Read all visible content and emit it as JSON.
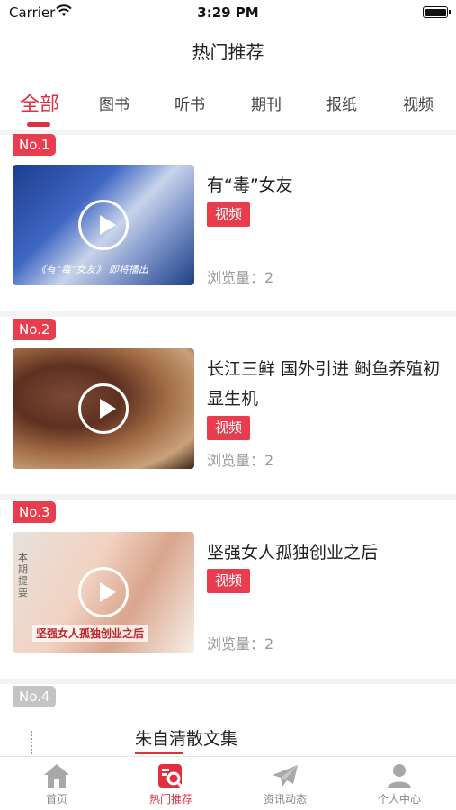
{
  "status": {
    "carrier": "Carrier",
    "time": "3:29 PM"
  },
  "nav": {
    "title": "热门推荐"
  },
  "tabs": [
    {
      "label": "全部",
      "active": true
    },
    {
      "label": "图书",
      "active": false
    },
    {
      "label": "听书",
      "active": false
    },
    {
      "label": "期刊",
      "active": false
    },
    {
      "label": "报纸",
      "active": false
    },
    {
      "label": "视频",
      "active": false
    }
  ],
  "items": [
    {
      "rank": "No.1",
      "title": "有“毒”女友",
      "tag": "视频",
      "views": "浏览量：2",
      "thumb_caption": "《有“毒”女友》  即将播出"
    },
    {
      "rank": "No.2",
      "title": "长江三鲜 国外引进 鲥鱼养殖初显生机",
      "tag": "视频",
      "views": "浏览量：2"
    },
    {
      "rank": "No.3",
      "title": "坚强女人孤独创业之后",
      "tag": "视频",
      "views": "浏览量：2",
      "thumb_caption": "坚强女人孤独创业之后",
      "thumb_side": "本期提要"
    },
    {
      "rank": "No.4",
      "title": "朱自清散文集"
    }
  ],
  "tabbar": [
    {
      "label": "首页",
      "icon": "home-icon",
      "active": false
    },
    {
      "label": "热门推荐",
      "icon": "hot-recommend-icon",
      "active": true
    },
    {
      "label": "资讯动态",
      "icon": "paper-plane-icon",
      "active": false
    },
    {
      "label": "个人中心",
      "icon": "user-icon",
      "active": false
    }
  ],
  "colors": {
    "accent": "#e0303f",
    "badge": "#e83d4f",
    "badge_inactive": "#c4c4c4",
    "muted": "#999999"
  }
}
